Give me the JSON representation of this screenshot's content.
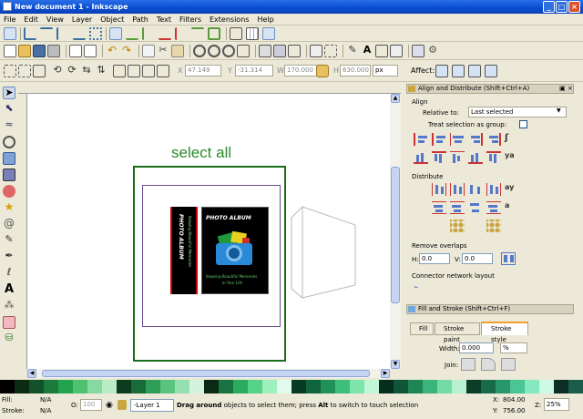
{
  "window": {
    "title": "New document 1 - Inkscape",
    "min": "_",
    "max": "□",
    "close": "×"
  },
  "menu": [
    "File",
    "Edit",
    "View",
    "Layer",
    "Object",
    "Path",
    "Text",
    "Filters",
    "Extensions",
    "Help"
  ],
  "tool_controls": {
    "x_label": "X",
    "x_value": "47.149",
    "y_label": "Y",
    "y_value": "-31.314",
    "w_label": "W",
    "w_value": "170.000",
    "h_label": "H",
    "h_value": "630.000",
    "unit": "px",
    "affect_label": "Affect:"
  },
  "canvas": {
    "select_all_text": "select all"
  },
  "album": {
    "spine_title": "PHOTO ALBUM",
    "spine_sub": "Keeping Beautiful Memories",
    "front_title": "PHOTO ALBUM",
    "front_sub1": "Keeping Beautiful Memories",
    "front_sub2": "In Your Life"
  },
  "align_panel": {
    "title": "Align and Distribute (Shift+Ctrl+A)",
    "align_label": "Align",
    "relative_label": "Relative to:",
    "relative_value": "Last selected",
    "group_label": "Treat selection as group:",
    "distribute_label": "Distribute",
    "remove_overlaps_label": "Remove overlaps",
    "h_label": "H:",
    "h_value": "0.0",
    "v_label": "V:",
    "v_value": "0.0",
    "connector_label": "Connector network layout"
  },
  "fill_panel": {
    "title": "Fill and Stroke (Shift+Ctrl+F)",
    "tab_fill": "Fill",
    "tab_stroke_paint": "Stroke paint",
    "tab_stroke_style": "Stroke style",
    "width_label": "Width:",
    "width_value": "0.000",
    "width_unit": "%",
    "join_label": "Join:"
  },
  "status": {
    "fill_label": "Fill:",
    "fill_value": "N/A",
    "stroke_label": "Stroke:",
    "stroke_value": "N/A",
    "opacity_label": "O:",
    "opacity_value": "100",
    "layer": "-Layer 1",
    "message_bold": "Drag around",
    "message_rest": " objects to select them; press ",
    "message_bold2": "Alt",
    "message_end": " to switch to touch selection",
    "x_label": "X:",
    "x_value": "804.00",
    "y_label": "Y:",
    "y_value": "756.00",
    "z_label": "Z:",
    "zoom_value": "25%"
  },
  "colors": {
    "accent": "#2a6ee8",
    "frame_green": "#1a6e1a",
    "text_green": "#2e8b2e"
  }
}
